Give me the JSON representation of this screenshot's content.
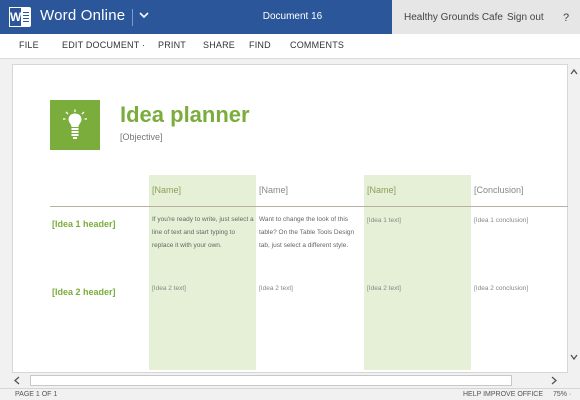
{
  "titlebar": {
    "app_name": "Word Online",
    "logo_letter": "W",
    "document_title": "Document 16",
    "account_name": "Healthy Grounds Cafe",
    "sign_out": "Sign out",
    "help": "?",
    "color": "#2b579a"
  },
  "menu": {
    "items": [
      {
        "label": "FILE"
      },
      {
        "label": "EDIT DOCUMENT ·"
      },
      {
        "label": "PRINT"
      },
      {
        "label": "SHARE"
      },
      {
        "label": "FIND"
      },
      {
        "label": "COMMENTS"
      }
    ]
  },
  "document": {
    "title": "Idea planner",
    "objective": "[Objective]",
    "accent": "#7aad3c",
    "column_headers": [
      "[Name]",
      "[Name]",
      "[Name]",
      "[Conclusion]"
    ],
    "rows": [
      {
        "header": "[Idea 1 header]",
        "cells": [
          "If you're ready to write, just select a line of text and start typing to replace it with your own.",
          "Want to change the look of this table? On the Table Tools Design tab, just select a different style.",
          "[Idea 1 text]",
          "[Idea 1 conclusion]"
        ]
      },
      {
        "header": "[Idea 2 header]",
        "cells": [
          "[Idea 2 text]",
          "[Idea 2 text]",
          "[Idea 2 text]",
          "[Idea 2 conclusion]"
        ]
      }
    ]
  },
  "statusbar": {
    "page": "PAGE 1 OF 1",
    "help_improve": "HELP IMPROVE OFFICE",
    "zoom": "75% ·"
  }
}
